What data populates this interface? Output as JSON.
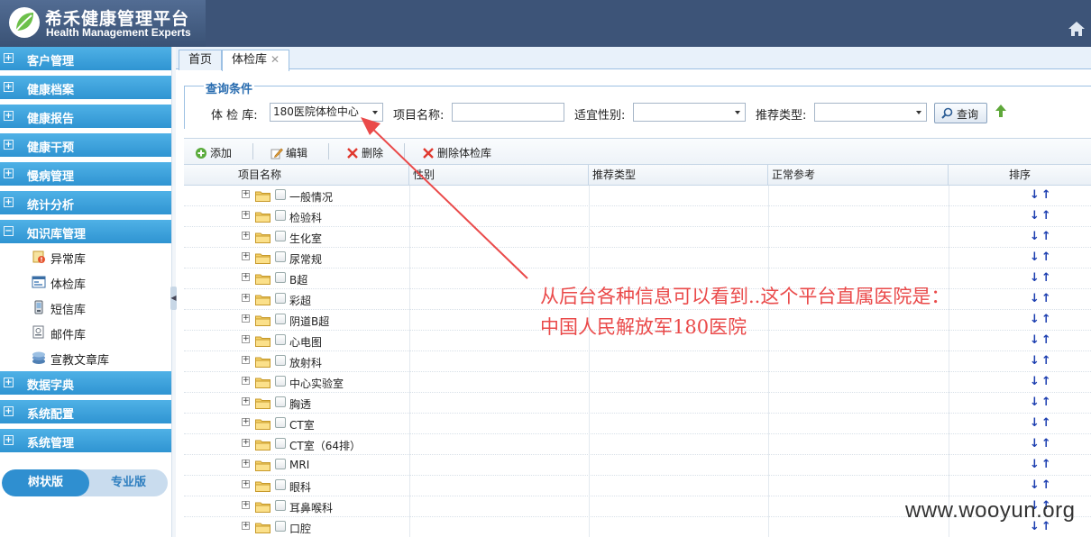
{
  "header": {
    "title": "希禾健康管理平台",
    "subtitle": "Health Management Experts"
  },
  "sidebar": {
    "items": [
      {
        "label": "客户管理",
        "expanded": false
      },
      {
        "label": "健康档案",
        "expanded": false
      },
      {
        "label": "健康报告",
        "expanded": false
      },
      {
        "label": "健康干预",
        "expanded": false
      },
      {
        "label": "慢病管理",
        "expanded": false
      },
      {
        "label": "统计分析",
        "expanded": false
      },
      {
        "label": "知识库管理",
        "expanded": true
      },
      {
        "label": "数据字典",
        "expanded": false
      },
      {
        "label": "系统配置",
        "expanded": false
      },
      {
        "label": "系统管理",
        "expanded": false
      }
    ],
    "subitems": [
      {
        "label": "异常库",
        "icon": "exception-icon"
      },
      {
        "label": "体检库",
        "icon": "exam-library-icon"
      },
      {
        "label": "短信库",
        "icon": "sms-icon"
      },
      {
        "label": "邮件库",
        "icon": "mail-icon"
      },
      {
        "label": "宣教文章库",
        "icon": "article-icon"
      }
    ],
    "mode": {
      "tree": "树状版",
      "pro": "专业版"
    }
  },
  "tabs": [
    {
      "label": "首页",
      "active": false
    },
    {
      "label": "体检库",
      "active": true,
      "close": "✕"
    }
  ],
  "query": {
    "legend": "查询条件",
    "library_label": "体 检 库:",
    "library_value": "180医院体检中心",
    "item_name_label": "项目名称:",
    "item_name_value": "",
    "gender_label": "适宜性别:",
    "gender_value": "",
    "recommend_label": "推荐类型:",
    "recommend_value": "",
    "search_button": "查询"
  },
  "toolbar": {
    "add": "添加",
    "edit": "编辑",
    "delete": "删除",
    "delete_library": "删除体检库"
  },
  "grid": {
    "columns": [
      "项目名称",
      "性别",
      "推荐类型",
      "正常参考",
      "排序"
    ],
    "sort_glyphs": "↓↑",
    "rows": [
      "一般情况",
      "检验科",
      "生化室",
      "尿常规",
      "B超",
      "彩超",
      "阴道B超",
      "心电图",
      "放射科",
      "中心实验室",
      "胸透",
      "CT室",
      "CT室（64排）",
      "MRI",
      "眼科",
      "耳鼻喉科",
      "口腔"
    ]
  },
  "annotation": {
    "line1": "从后台各种信息可以看到..这个平台直属医院是：",
    "line2": "中国人民解放军180医院",
    "color": "#ea4a4a"
  },
  "watermark": "www.wooyun.org",
  "colors": {
    "header_bg": "#3d5478",
    "nav_blue": "#2f94d2",
    "accent_text": "#2a6db0"
  }
}
